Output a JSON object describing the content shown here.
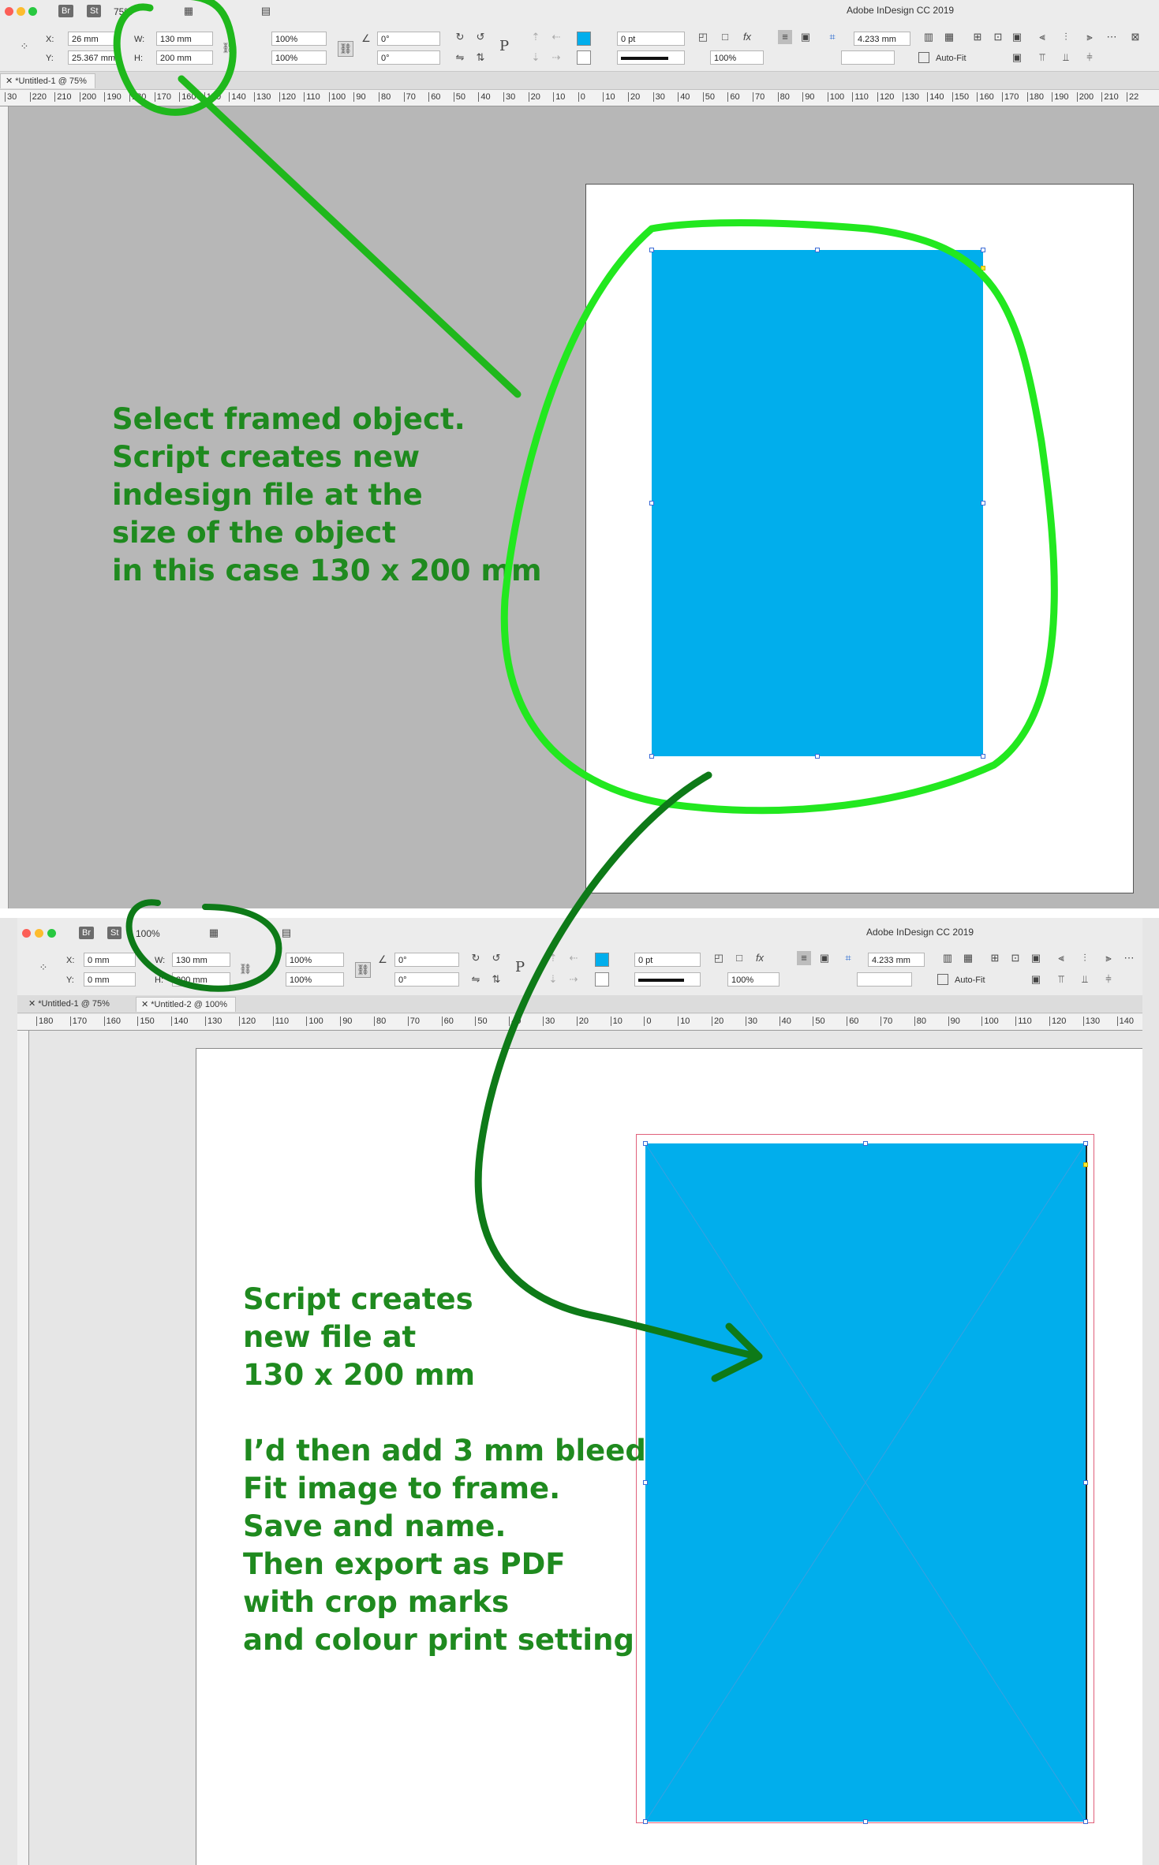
{
  "app_title": "Adobe InDesign CC 2019",
  "top_screenshot": {
    "zoom": "75%",
    "bridge_label": "Br",
    "stock_label": "St",
    "x_label": "X:",
    "y_label": "Y:",
    "w_label": "W:",
    "h_label": "H:",
    "x_value": "26 mm",
    "y_value": "25.367 mm",
    "w_value": "130 mm",
    "h_value": "200 mm",
    "scale_x": "100%",
    "scale_y": "100%",
    "rotate": "0°",
    "shear": "0°",
    "stroke_weight": "0 pt",
    "opacity": "100%",
    "corner_size": "4.233 mm",
    "auto_fit": "Auto-Fit",
    "tab_label": "*Untitled-1 @ 75%",
    "ruler_labels": [
      "30",
      "220",
      "210",
      "200",
      "190",
      "180",
      "170",
      "160",
      "150",
      "140",
      "130",
      "120",
      "110",
      "100",
      "90",
      "80",
      "70",
      "60",
      "50",
      "40",
      "30",
      "20",
      "10",
      "0",
      "10",
      "20",
      "30",
      "40",
      "50",
      "60",
      "70",
      "80",
      "90",
      "100",
      "110",
      "120",
      "130",
      "140",
      "150",
      "160",
      "170",
      "180",
      "190",
      "200",
      "210",
      "22"
    ]
  },
  "bottom_screenshot": {
    "zoom": "100%",
    "bridge_label": "Br",
    "stock_label": "St",
    "x_label": "X:",
    "y_label": "Y:",
    "w_label": "W:",
    "h_label": "H:",
    "x_value": "0 mm",
    "y_value": "0 mm",
    "w_value": "130 mm",
    "h_value": "200 mm",
    "scale_x": "100%",
    "scale_y": "100%",
    "rotate": "0°",
    "shear": "0°",
    "stroke_weight": "0 pt",
    "opacity": "100%",
    "corner_size": "4.233 mm",
    "auto_fit": "Auto-Fit",
    "tab1_label": "*Untitled-1 @ 75%",
    "tab2_label": "*Untitled-2 @ 100%",
    "ruler_labels": [
      "180",
      "170",
      "160",
      "150",
      "140",
      "130",
      "120",
      "110",
      "100",
      "90",
      "80",
      "70",
      "60",
      "50",
      "40",
      "30",
      "20",
      "10",
      "0",
      "10",
      "20",
      "30",
      "40",
      "50",
      "60",
      "70",
      "80",
      "90",
      "100",
      "110",
      "120",
      "130",
      "140"
    ]
  },
  "annotations": {
    "top_lines": [
      "Select framed object.",
      "Script creates new",
      "indesign file at the",
      "size of the object",
      "in this case 130 x 200 mm"
    ],
    "bottom_lines": [
      "Script creates",
      "new file at",
      "130 x 200 mm",
      "",
      "I’d then add 3 mm bleed",
      "Fit image to frame.",
      "Save and name.",
      "Then export as PDF",
      "with crop marks",
      "and colour print setting"
    ]
  },
  "colors": {
    "frame_fill": "#01aeec",
    "annotation_green": "#1f8a1f",
    "highlight_green": "#22e81f",
    "arrow_green": "#0e7a18",
    "pasteboard_top": "#b7b7b7",
    "pasteboard_bottom": "#e6e6e6",
    "bleed_guide": "#e0607a"
  }
}
